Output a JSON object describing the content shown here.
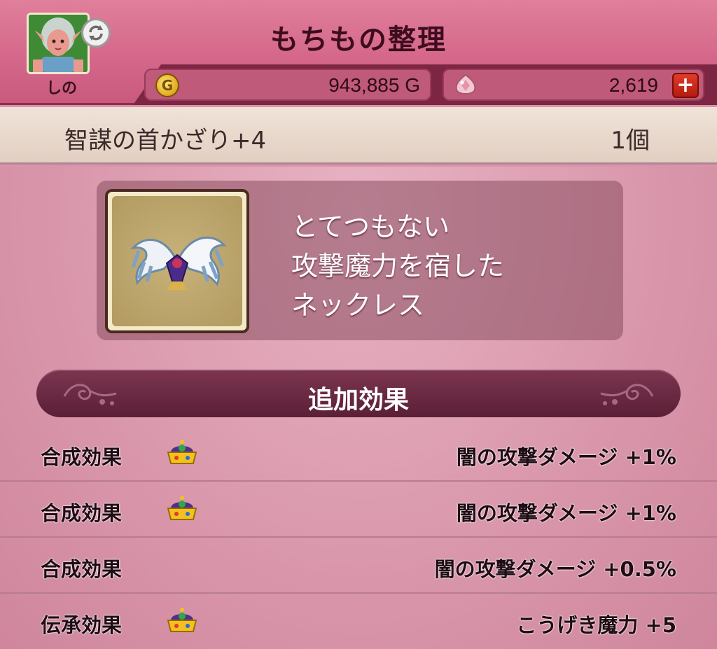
{
  "header": {
    "title": "もちもの整理",
    "player_name": "しの",
    "gold": "943,885 G",
    "gems": "2,619",
    "icons": {
      "swap": "swap-arrows-icon",
      "coin": "gold-coin-icon",
      "gem": "gem-icon",
      "plus": "plus-icon"
    },
    "colors": {
      "accent": "#d5688a",
      "dark": "#7c2643"
    }
  },
  "item": {
    "name": "智謀の首かざり+4",
    "count": "1個",
    "icon": "winged-necklace-icon",
    "description": [
      "とてつもない",
      "攻撃魔力を宿した",
      "ネックレス"
    ]
  },
  "section": {
    "title": "追加効果"
  },
  "effects": [
    {
      "label": "合成効果",
      "has_crown": true,
      "value": "闇の攻撃ダメージ +1%"
    },
    {
      "label": "合成効果",
      "has_crown": true,
      "value": "闇の攻撃ダメージ +1%"
    },
    {
      "label": "合成効果",
      "has_crown": false,
      "value": "闇の攻撃ダメージ +0.5%"
    },
    {
      "label": "伝承効果",
      "has_crown": true,
      "value": "こうげき魔力 +5"
    }
  ]
}
